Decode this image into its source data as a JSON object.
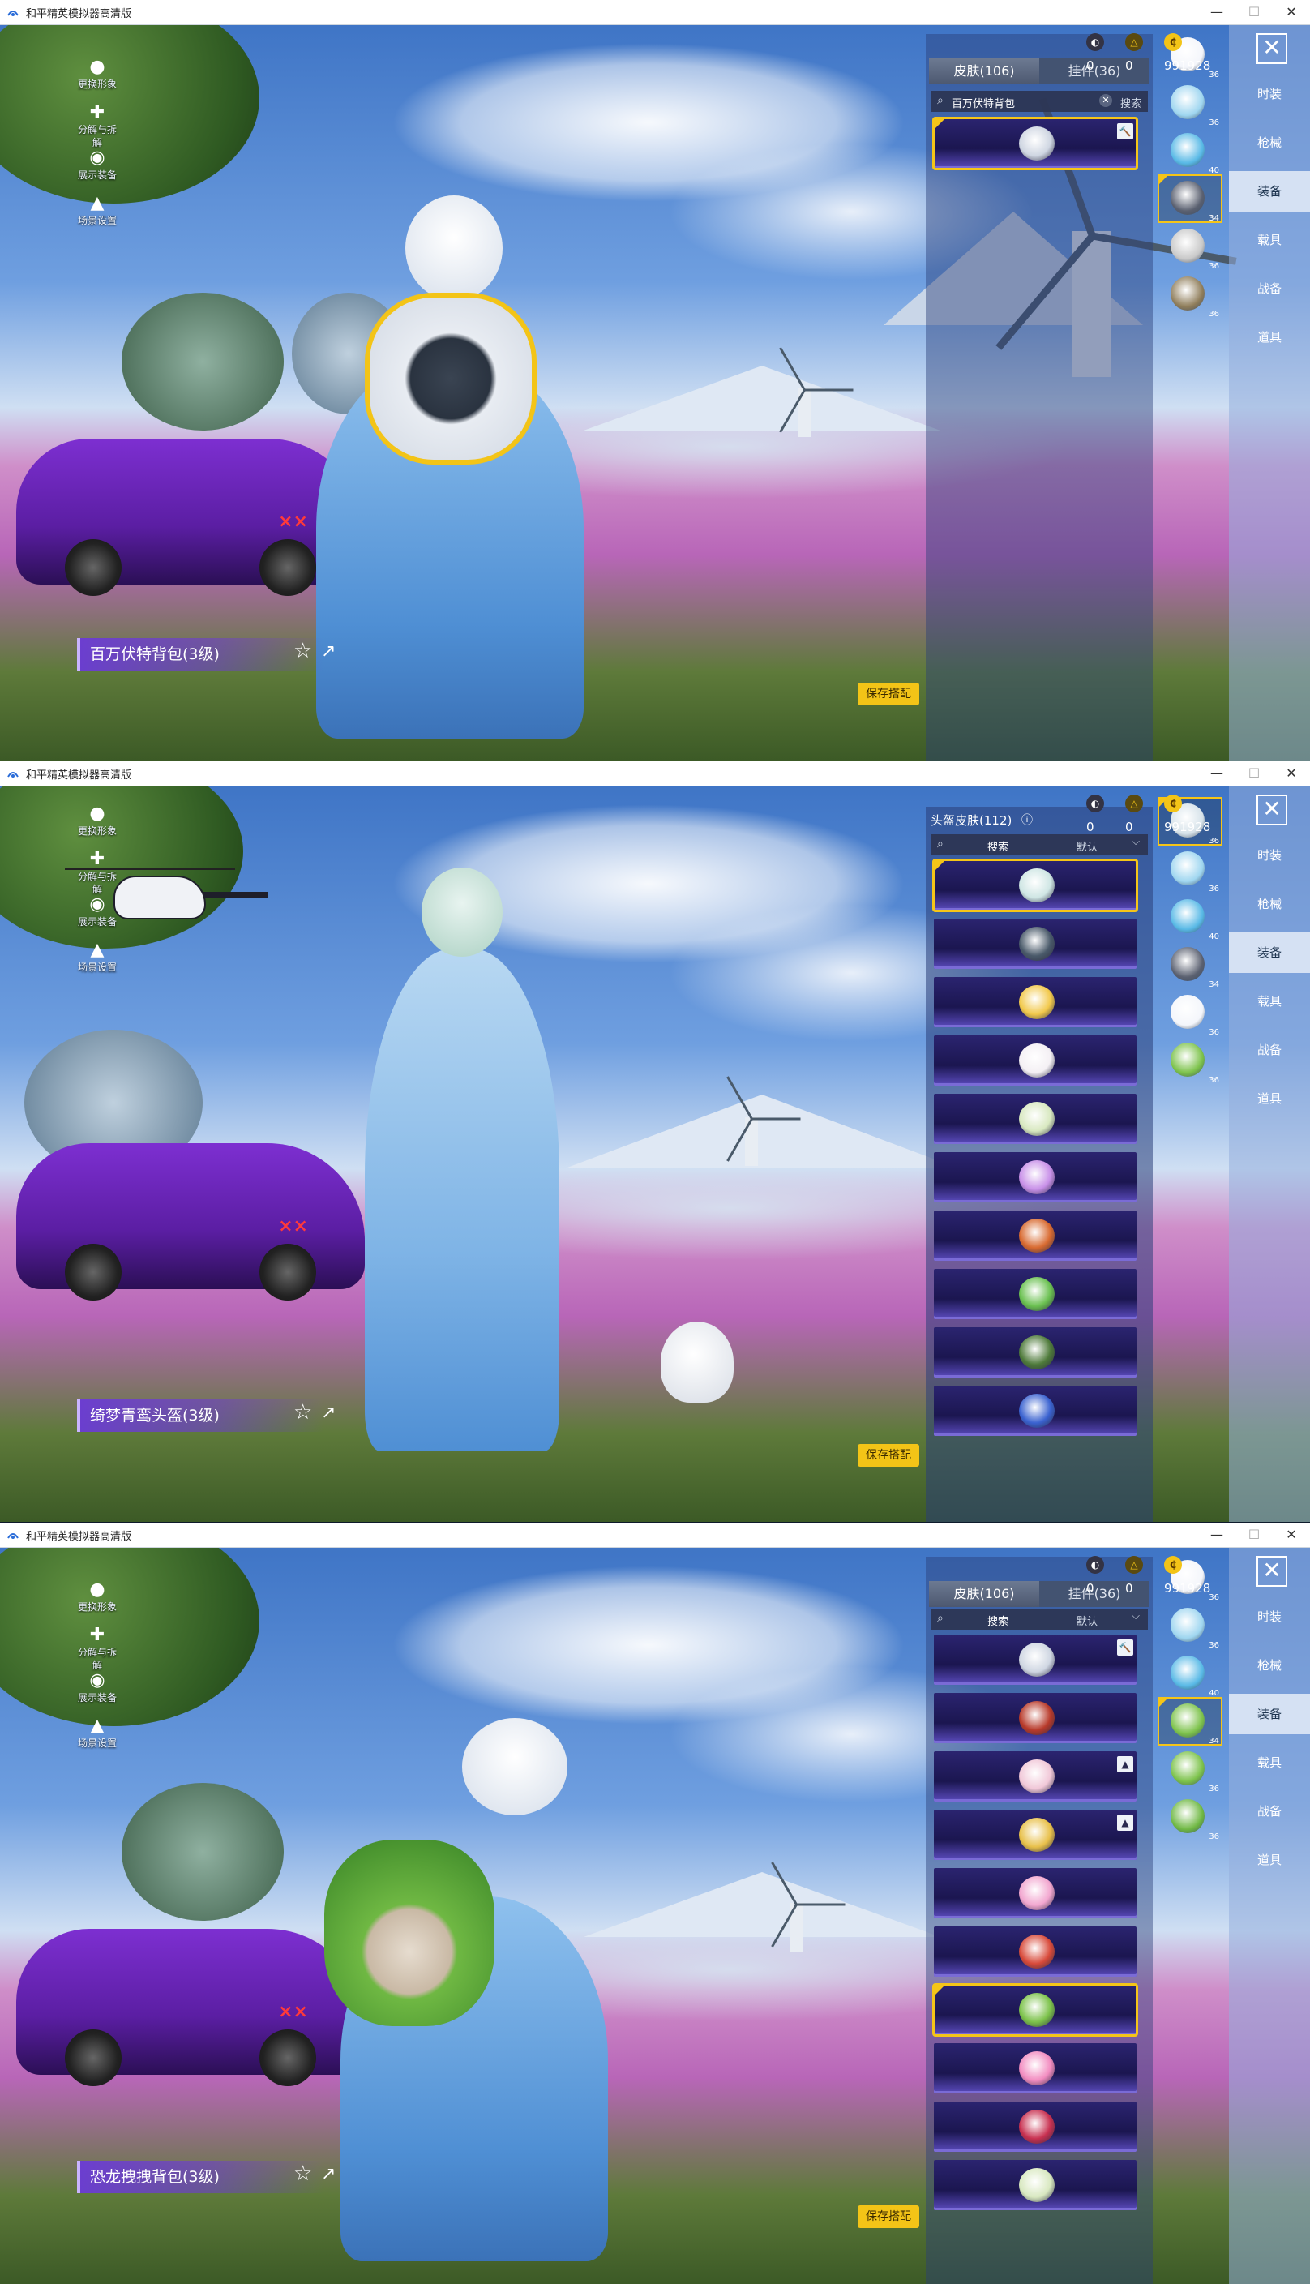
{
  "window": {
    "title": "和平精英模拟器高清版",
    "min": "—",
    "max": "☐",
    "close": "✕"
  },
  "left_menu": [
    {
      "label": "更换形象",
      "icon": "person-icon"
    },
    {
      "label": "分解与拆解",
      "icon": "puzzle-icon"
    },
    {
      "label": "展示装备",
      "icon": "eye-icon"
    },
    {
      "label": "场景设置",
      "icon": "pin-icon"
    }
  ],
  "currency": {
    "a": "0",
    "b": "0",
    "coins": "991928"
  },
  "tabs": {
    "skin": "皮肤(106)",
    "pendant": "挂件(36)"
  },
  "helmet_title": "头盔皮肤(112)",
  "search": {
    "placeholder": "搜索",
    "default": "默认",
    "query": "百万伏特背包",
    "button": "搜索"
  },
  "categories": [
    "时装",
    "枪械",
    "装备",
    "载具",
    "战备",
    "道具"
  ],
  "active_category": "装备",
  "close_label": "✕",
  "save_label": "保存搭配",
  "screens": [
    {
      "item_name": "百万伏特背包(3级)",
      "slots": [
        {
          "num": "36",
          "color": "#f4f6fb"
        },
        {
          "num": "36",
          "color": "#9fd6f0"
        },
        {
          "num": "40",
          "color": "#58b9e6"
        },
        {
          "num": "34",
          "color": "#5a6070",
          "selected": true
        },
        {
          "num": "36",
          "color": "#c9c9c9"
        },
        {
          "num": "36",
          "color": "#8f7d5a"
        }
      ],
      "items": [
        {
          "color": "#cfd6e2",
          "badge": "🔨",
          "selected": true
        }
      ]
    },
    {
      "item_name": "绮梦青鸾头盔(3级)",
      "slots": [
        {
          "num": "36",
          "color": "#d7e3ea",
          "selected": true
        },
        {
          "num": "36",
          "color": "#9fd6f0"
        },
        {
          "num": "40",
          "color": "#58b9e6"
        },
        {
          "num": "34",
          "color": "#5a6070"
        },
        {
          "num": "36",
          "color": "#f4f6fb"
        },
        {
          "num": "36",
          "color": "#7cc24a"
        }
      ],
      "items": [
        {
          "color": "#cfe6e4",
          "selected": true
        },
        {
          "color": "#4a5a6a"
        },
        {
          "color": "#f2c94c"
        },
        {
          "color": "#f4f0f4"
        },
        {
          "color": "#d8e8c0"
        },
        {
          "color": "#c890e8"
        },
        {
          "color": "#d86a30"
        },
        {
          "color": "#6ac050"
        },
        {
          "color": "#4e7a3a"
        },
        {
          "color": "#3a62d0"
        }
      ]
    },
    {
      "item_name": "恐龙拽拽背包(3级)",
      "slots": [
        {
          "num": "36",
          "color": "#f4f6fb"
        },
        {
          "num": "36",
          "color": "#9fd6f0"
        },
        {
          "num": "40",
          "color": "#58b9e6"
        },
        {
          "num": "34",
          "color": "#7cc24a",
          "selected": true
        },
        {
          "num": "36",
          "color": "#7cc24a"
        },
        {
          "num": "36",
          "color": "#6fb843"
        }
      ],
      "items": [
        {
          "color": "#cfd6e2",
          "badge": "🔨"
        },
        {
          "color": "#b83a2a"
        },
        {
          "color": "#f1c8d8",
          "badge": "▲"
        },
        {
          "color": "#e8c04a",
          "badge": "▲"
        },
        {
          "color": "#f2a6cf"
        },
        {
          "color": "#d84a3a"
        },
        {
          "color": "#7cc24a",
          "selected": true
        },
        {
          "color": "#f28cc0"
        },
        {
          "color": "#c83050"
        },
        {
          "color": "#d8e8c0"
        }
      ]
    }
  ]
}
